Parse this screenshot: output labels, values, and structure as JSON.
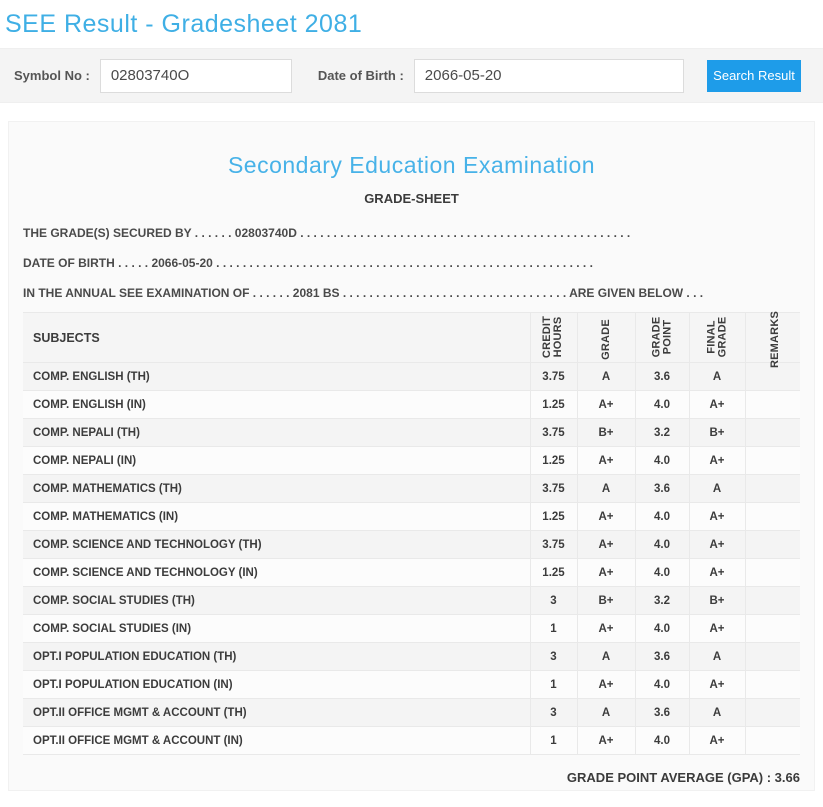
{
  "page": {
    "title": "SEE Result - Gradesheet 2081"
  },
  "search": {
    "symbol_label": "Symbol No :",
    "symbol_value": "02803740O",
    "dob_label": "Date of Birth :",
    "dob_value": "2066-05-20",
    "button_label": "Search Result"
  },
  "sheet": {
    "heading": "Secondary Education Examination",
    "subheading": "GRADE-SHEET",
    "line_secured": "THE GRADE(S) SECURED BY . . . . . . 02803740D . . . . . . . . . . . . . . . . . . . . . . . . . . . . . . . . . . . . . . . . . . . . . . . . . .",
    "line_dob": "DATE OF BIRTH . . . . . 2066-05-20 . . . . . . . . . . . . . . . . . . . . . . . . . . . . . . . . . . . . . . . . . . . . . . . . . . . . . . . . .",
    "line_exam": "IN THE ANNUAL SEE EXAMINATION OF . . . . . . 2081 BS . . . . . . . . . . . . . . . . . . . . . . . . . . . . . . . . . . ARE GIVEN BELOW . . .",
    "gpa_line": "GRADE POINT AVERAGE (GPA) : 3.66"
  },
  "table": {
    "headers": [
      "SUBJECTS",
      "CREDIT\nHOURS",
      "GRADE",
      "GRADE\nPOINT",
      "FINAL\nGRADE",
      "REMARKS"
    ],
    "rows": [
      {
        "subject": "COMP. ENGLISH (TH)",
        "credit": "3.75",
        "grade": "A",
        "point": "3.6",
        "final": "A",
        "remarks": ""
      },
      {
        "subject": "COMP. ENGLISH (IN)",
        "credit": "1.25",
        "grade": "A+",
        "point": "4.0",
        "final": "A+",
        "remarks": ""
      },
      {
        "subject": "COMP. NEPALI (TH)",
        "credit": "3.75",
        "grade": "B+",
        "point": "3.2",
        "final": "B+",
        "remarks": ""
      },
      {
        "subject": "COMP. NEPALI (IN)",
        "credit": "1.25",
        "grade": "A+",
        "point": "4.0",
        "final": "A+",
        "remarks": ""
      },
      {
        "subject": "COMP. MATHEMATICS (TH)",
        "credit": "3.75",
        "grade": "A",
        "point": "3.6",
        "final": "A",
        "remarks": ""
      },
      {
        "subject": "COMP. MATHEMATICS (IN)",
        "credit": "1.25",
        "grade": "A+",
        "point": "4.0",
        "final": "A+",
        "remarks": ""
      },
      {
        "subject": "COMP. SCIENCE AND TECHNOLOGY (TH)",
        "credit": "3.75",
        "grade": "A+",
        "point": "4.0",
        "final": "A+",
        "remarks": ""
      },
      {
        "subject": "COMP. SCIENCE AND TECHNOLOGY (IN)",
        "credit": "1.25",
        "grade": "A+",
        "point": "4.0",
        "final": "A+",
        "remarks": ""
      },
      {
        "subject": "COMP. SOCIAL STUDIES (TH)",
        "credit": "3",
        "grade": "B+",
        "point": "3.2",
        "final": "B+",
        "remarks": ""
      },
      {
        "subject": "COMP. SOCIAL STUDIES (IN)",
        "credit": "1",
        "grade": "A+",
        "point": "4.0",
        "final": "A+",
        "remarks": ""
      },
      {
        "subject": "OPT.I POPULATION EDUCATION (TH)",
        "credit": "3",
        "grade": "A",
        "point": "3.6",
        "final": "A",
        "remarks": ""
      },
      {
        "subject": "OPT.I POPULATION EDUCATION (IN)",
        "credit": "1",
        "grade": "A+",
        "point": "4.0",
        "final": "A+",
        "remarks": ""
      },
      {
        "subject": "OPT.II OFFICE MGMT & ACCOUNT (TH)",
        "credit": "3",
        "grade": "A",
        "point": "3.6",
        "final": "A",
        "remarks": ""
      },
      {
        "subject": "OPT.II OFFICE MGMT & ACCOUNT (IN)",
        "credit": "1",
        "grade": "A+",
        "point": "4.0",
        "final": "A+",
        "remarks": ""
      }
    ]
  },
  "colors": {
    "title_blue": "#3fafe5",
    "heading_blue": "#47b2e8",
    "button_blue": "#1e9ce9",
    "bar_bg": "#f4f4f4",
    "panel_bg": "#fafafa",
    "row_stripe": "#f4f4f4",
    "border_gray": "#e9e9e9"
  }
}
